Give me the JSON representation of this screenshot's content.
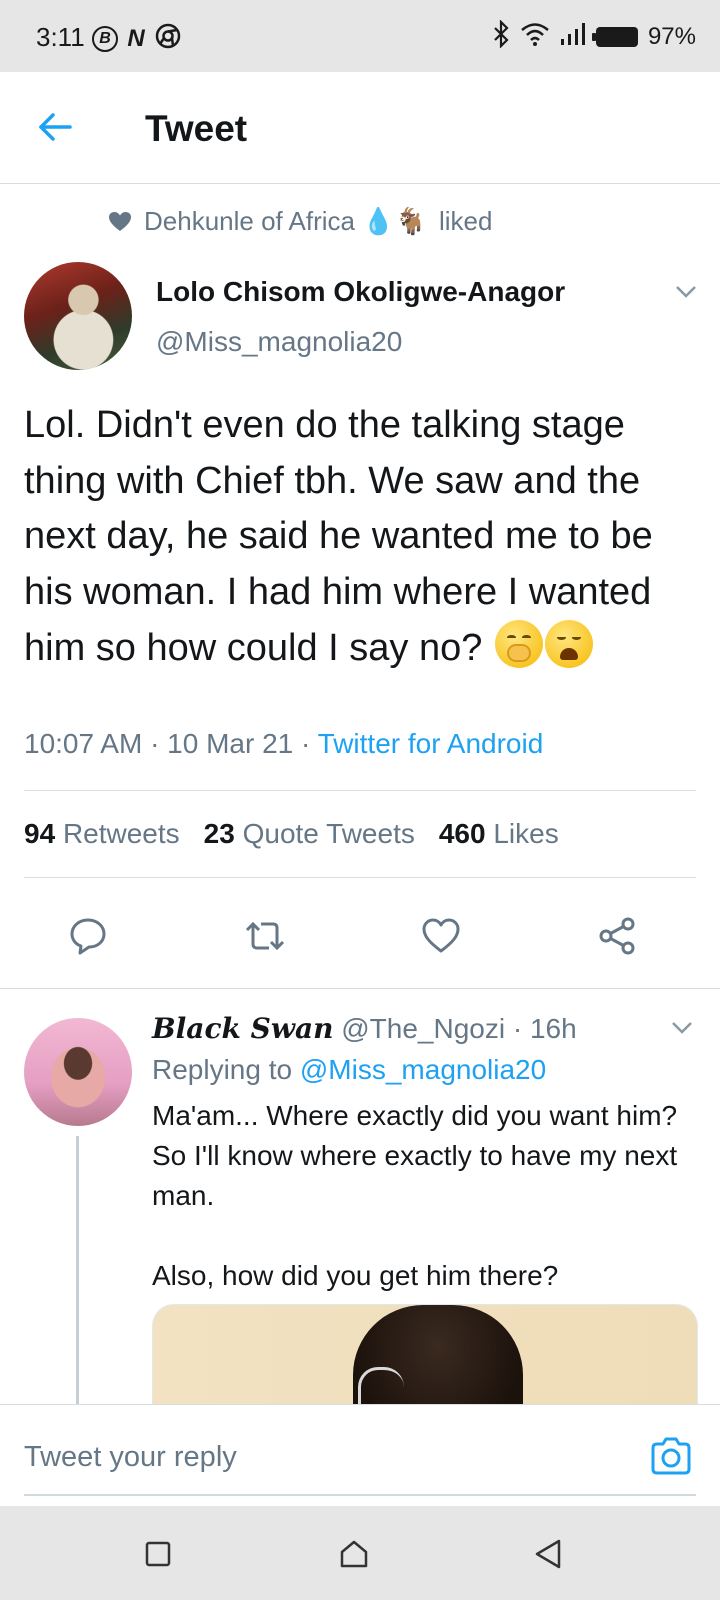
{
  "status_bar": {
    "time": "3:11",
    "icons": [
      "b-circle-icon",
      "n-icon",
      "chrome-icon",
      "bluetooth-icon",
      "wifi-icon",
      "signal-icon",
      "battery-icon"
    ],
    "b_icon_glyph": "B",
    "n_icon_glyph": "N",
    "battery": "97%"
  },
  "header": {
    "title": "Tweet"
  },
  "social_context": {
    "name": "Dehkunle of Africa 💧🐐",
    "action": "liked"
  },
  "tweet": {
    "author_name": "Lolo Chisom Okoligwe-Anagor",
    "author_handle": "@Miss_magnolia20",
    "text": "Lol. Didn't even do the talking stage thing with Chief tbh. We saw and the next day, he said he wanted me to be his woman. I had him where I wanted him so how could I say no?",
    "emoji": [
      "hand-over-mouth-emoji",
      "weary-face-emoji"
    ],
    "time": "10:07 AM · 10 Mar 21 · ",
    "source": "Twitter for Android",
    "stats": {
      "retweets_count": "94",
      "retweets_label": "Retweets",
      "quotes_count": "23",
      "quotes_label": "Quote Tweets",
      "likes_count": "460",
      "likes_label": "Likes"
    }
  },
  "reply": {
    "name": "Black Swan",
    "handle": "@The_Ngozi",
    "age": "· 16h",
    "replying_prefix": "Replying to ",
    "replying_to": "@Miss_magnolia20",
    "text": "Ma'am... Where exactly did you want him? So I'll know where exactly to have my next man.\n\nAlso, how did you get him there?"
  },
  "composer": {
    "placeholder": "Tweet your reply"
  },
  "colors": {
    "accent": "#1da1f2",
    "secondary_text": "#657786",
    "primary_text": "#14171a",
    "divider": "#d7dde2"
  }
}
